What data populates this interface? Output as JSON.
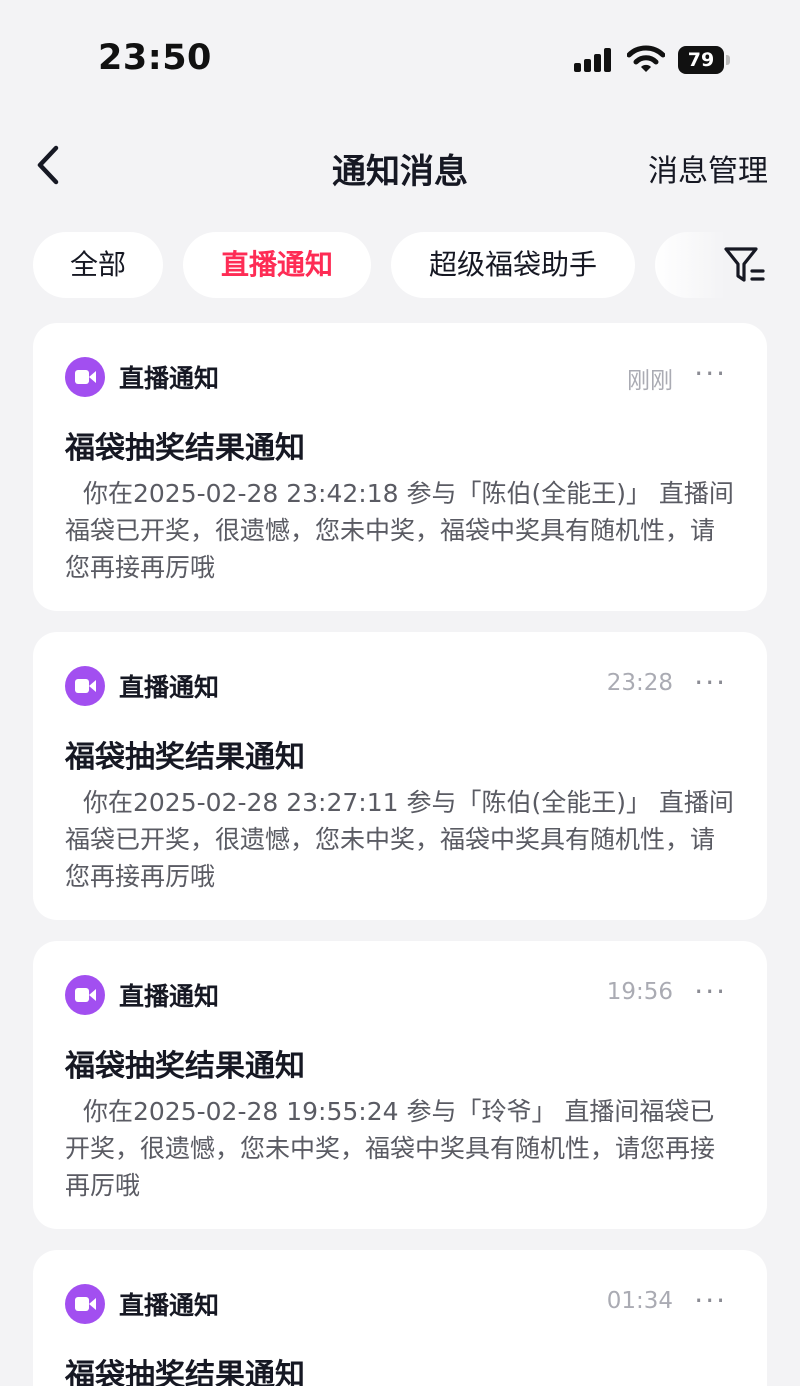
{
  "status_bar": {
    "time": "23:50",
    "battery": "79",
    "signal_icon": "cellular-signal-icon",
    "wifi_icon": "wifi-icon"
  },
  "nav": {
    "back_icon": "chevron-left-icon",
    "title": "通知消息",
    "action": "消息管理"
  },
  "tabs": [
    {
      "label": "全部",
      "active": false
    },
    {
      "label": "直播通知",
      "active": true
    },
    {
      "label": "超级福袋助手",
      "active": false
    }
  ],
  "filter_icon": "filter-icon",
  "accent_color": "#fe2c55",
  "icon_color": "#a24ff0",
  "cards": [
    {
      "source": "直播通知",
      "time": "刚刚",
      "more": "···",
      "title": "福袋抽奖结果通知",
      "body": "你在2025-02-28 23:42:18 参与「陈伯(全能王)」 直播间福袋已开奖，很遗憾，您未中奖，福袋中奖具有随机性，请您再接再厉哦"
    },
    {
      "source": "直播通知",
      "time": "23:28",
      "more": "···",
      "title": "福袋抽奖结果通知",
      "body": "你在2025-02-28 23:27:11 参与「陈伯(全能王)」 直播间福袋已开奖，很遗憾，您未中奖，福袋中奖具有随机性，请您再接再厉哦"
    },
    {
      "source": "直播通知",
      "time": "19:56",
      "more": "···",
      "title": "福袋抽奖结果通知",
      "body": "你在2025-02-28 19:55:24 参与「玲爷」 直播间福袋已开奖，很遗憾，您未中奖，福袋中奖具有随机性，请您再接再厉哦"
    },
    {
      "source": "直播通知",
      "time": "01:34",
      "more": "···",
      "title": "福袋抽奖结果通知",
      "body": ""
    }
  ]
}
